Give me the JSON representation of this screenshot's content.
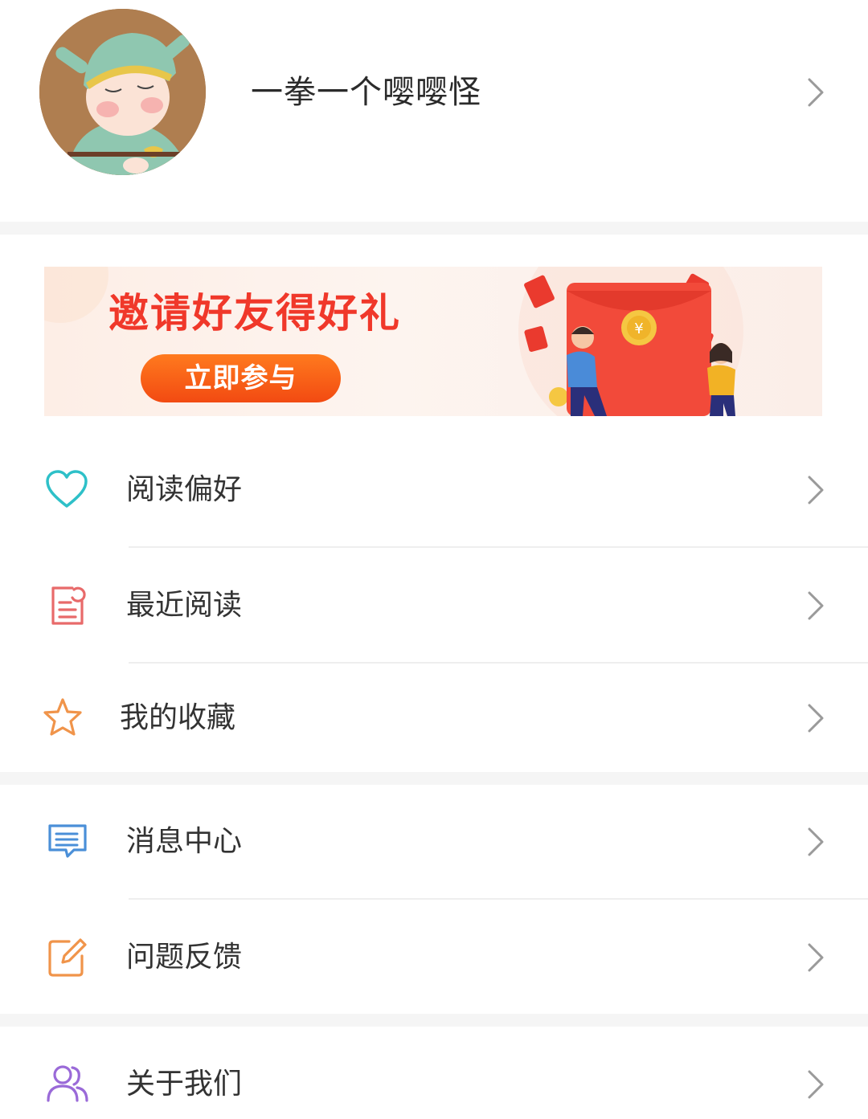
{
  "profile": {
    "username": "一拳一个嘤嘤怪"
  },
  "banner": {
    "title": "邀请好友得好礼",
    "button_label": "立即参与"
  },
  "menu_group_1": [
    {
      "label": "阅读偏好",
      "icon": "heart-icon",
      "color": "#2ec0c8"
    },
    {
      "label": "最近阅读",
      "icon": "document-icon",
      "color": "#e86a6a"
    },
    {
      "label": "我的收藏",
      "icon": "star-icon",
      "color": "#f0944a"
    }
  ],
  "menu_group_2": [
    {
      "label": "消息中心",
      "icon": "message-icon",
      "color": "#4a8fd8"
    },
    {
      "label": "问题反馈",
      "icon": "edit-icon",
      "color": "#f0944a"
    }
  ],
  "menu_group_3": [
    {
      "label": "关于我们",
      "icon": "users-icon",
      "color": "#9a6ad8"
    }
  ]
}
